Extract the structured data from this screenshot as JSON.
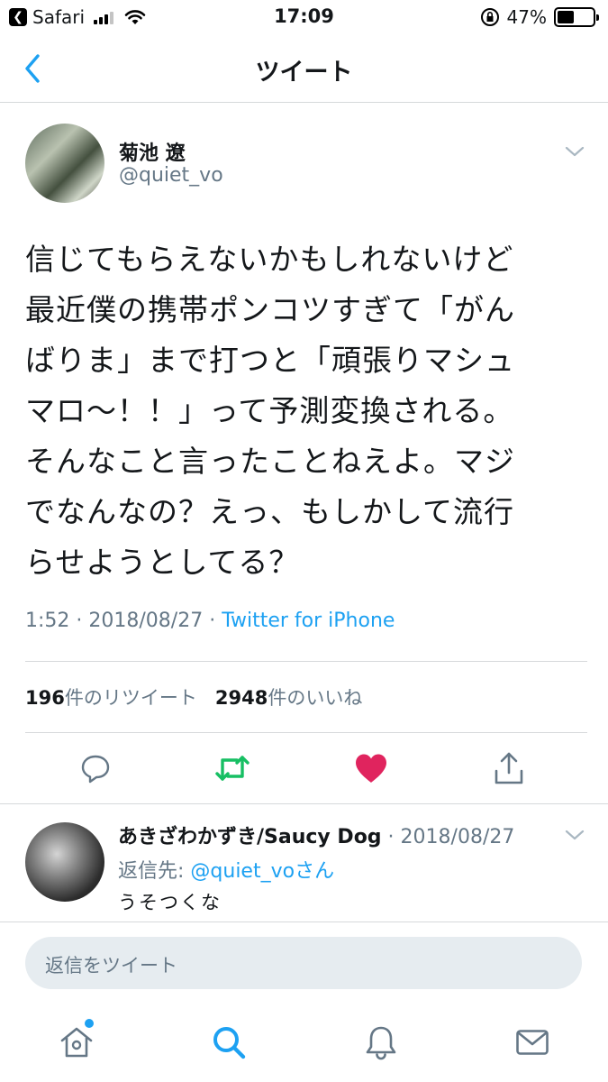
{
  "status_bar": {
    "back_app": "Safari",
    "time": "17:09",
    "battery_text": "47%",
    "battery_level": 0.47
  },
  "header": {
    "title": "ツイート"
  },
  "tweet": {
    "author_name": "菊池 遼",
    "author_handle": "@quiet_vo",
    "text": "信じてもらえないかもしれないけど\n最近僕の携帯ポンコツすぎて「がん\nばりま」まで打つと「頑張りマシュ\nマロ〜！！」って予測変換される。\nそんなこと言ったことねえよ。マジ\nでなんなの？えっ、もしかして流行\nらせようとしてる？",
    "time": "1:52",
    "separator": " · ",
    "date": "2018/08/27",
    "source": "Twitter for iPhone",
    "retweet_count": "196",
    "retweet_label": "件のリツイート",
    "like_count": "2948",
    "like_label": "件のいいね"
  },
  "reply": {
    "author_name": "あきざわかずき/Saucy Dog",
    "separator": " · ",
    "date": "2018/08/27",
    "reply_to_label": "返信先: ",
    "reply_to_mention": "@quiet_voさん",
    "text": "うそつくな"
  },
  "composer": {
    "placeholder": "返信をツイート"
  },
  "colors": {
    "accent": "#1da1f2",
    "retweet": "#17bf63",
    "like": "#e0245e",
    "secondary_text": "#657786",
    "divider": "#d6d9db",
    "composer_bg": "#e6ecf0"
  },
  "icons": {
    "status_back": "back-to-app-icon",
    "nav_back": "chevron-left-icon",
    "tweet_menu": "chevron-down-icon",
    "actions": [
      "reply-icon",
      "retweet-icon",
      "like-icon-filled",
      "share-icon"
    ],
    "tabs": [
      "home-icon",
      "search-icon",
      "notifications-icon",
      "messages-icon"
    ]
  }
}
